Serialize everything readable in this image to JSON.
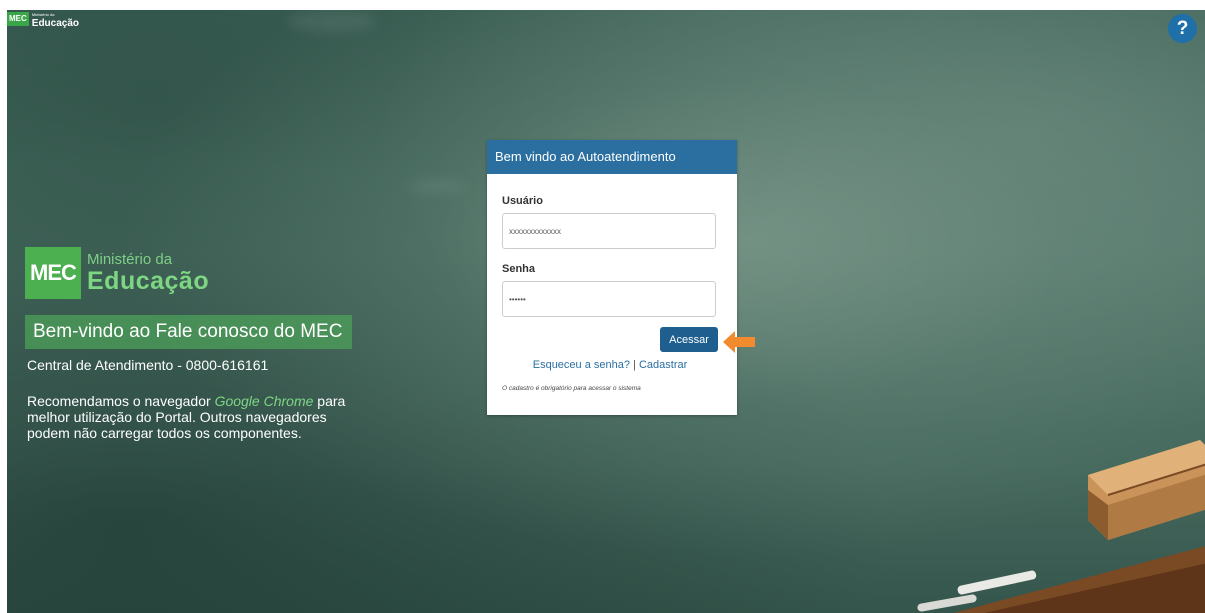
{
  "header": {
    "logo_box": "MEC",
    "logo_small": "Ministério da",
    "logo_big": "Educação"
  },
  "help": {
    "label": "?"
  },
  "brand": {
    "logo_box": "MEC",
    "line1": "Ministério da",
    "line2": "Educação"
  },
  "intro": {
    "welcome": "Bem-vindo ao Fale conosco do MEC",
    "central": "Central de Atendimento - 0800-616161",
    "recommend_pre": "Recomendamos o navegador ",
    "recommend_browser": "Google Chrome",
    "recommend_post": " para melhor utilização do Portal. Outros navegadores podem não carregar todos os componentes."
  },
  "login": {
    "title": "Bem vindo ao Autoatendimento",
    "user_label": "Usuário",
    "user_value": "xxxxxxxxxxxxx",
    "pass_label": "Senha",
    "pass_value": "••••••",
    "submit": "Acessar",
    "forgot": "Esqueceu a senha?",
    "separator": "|",
    "register": "Cadastrar",
    "disclaimer": "O cadastro é obrigatório para acessar o sistema"
  },
  "colors": {
    "brand_green": "#4caf50",
    "header_blue": "#2a6fa0",
    "button_blue": "#1f5f8f",
    "arrow_orange": "#f28a2e"
  }
}
